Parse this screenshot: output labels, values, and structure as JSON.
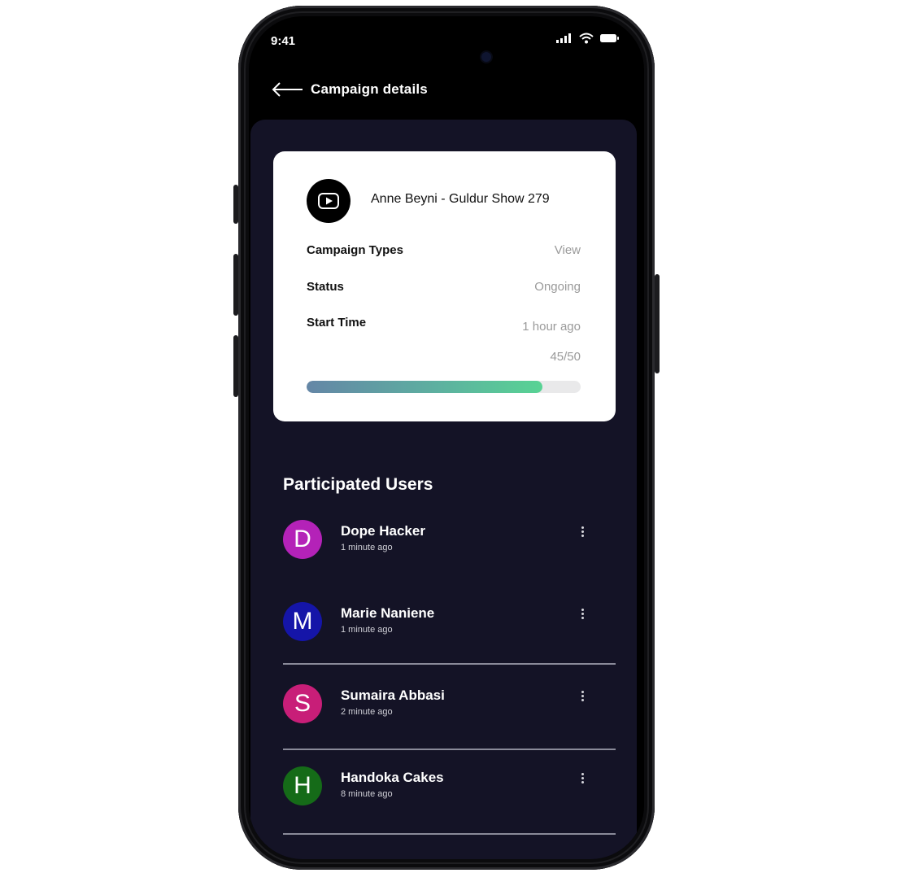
{
  "status_bar": {
    "time": "9:41"
  },
  "header": {
    "title": "Campaign details"
  },
  "campaign": {
    "platform_icon": "youtube-play-icon",
    "video_title": "Anne Beyni - Guldur Show 279",
    "rows": [
      {
        "label": "Campaign Types",
        "value": "View"
      },
      {
        "label": "Status",
        "value": "Ongoing"
      },
      {
        "label": "Start Time",
        "value": "1 hour ago"
      }
    ],
    "progress_text": "45/50",
    "progress_fraction": 0.86
  },
  "participants": {
    "title": "Participated Users",
    "users": [
      {
        "initial": "D",
        "name": "Dope Hacker",
        "time": "1 minute ago",
        "color": "#b422b8"
      },
      {
        "initial": "M",
        "name": "Marie Naniene",
        "time": "1 minute ago",
        "color": "#1515a8"
      },
      {
        "initial": "S",
        "name": "Sumaira Abbasi",
        "time": "2 minute ago",
        "color": "#c81e78"
      },
      {
        "initial": "H",
        "name": "Handoka Cakes",
        "time": "8 minute ago",
        "color": "#156b18"
      }
    ]
  },
  "colors": {
    "screen_background": "#141326",
    "progress_start": "#6486a6",
    "progress_end": "#58d394"
  }
}
